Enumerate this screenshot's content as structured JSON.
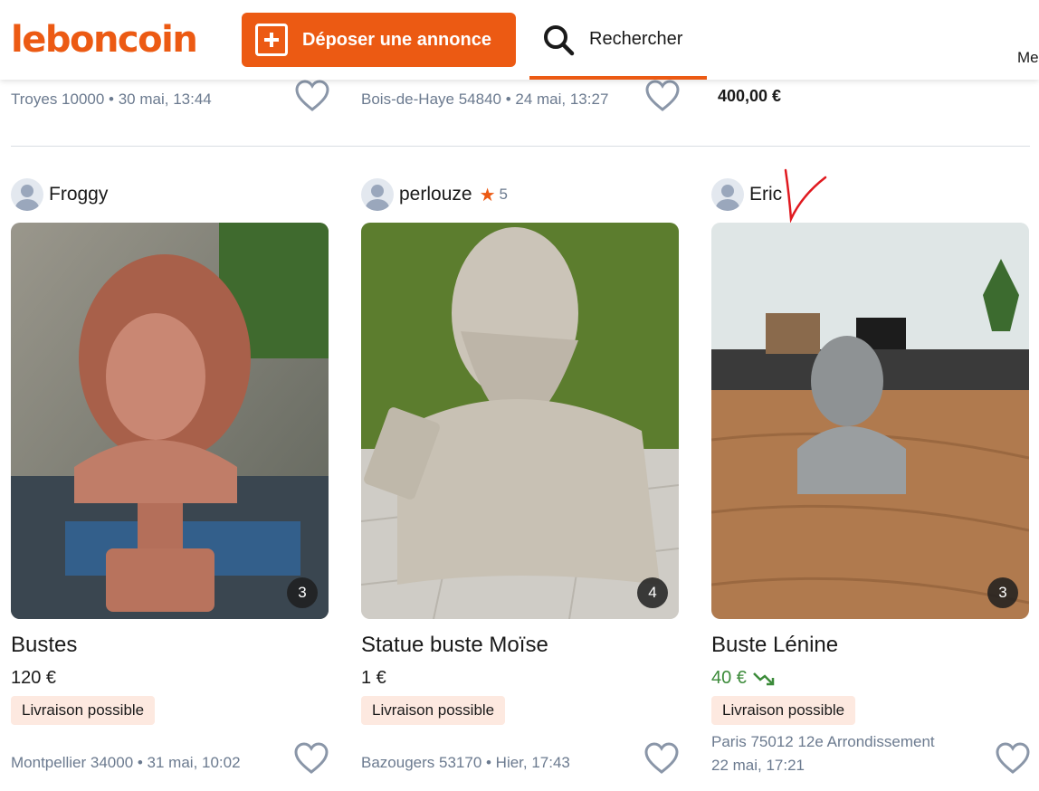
{
  "header": {
    "logo": "leboncoin",
    "post_button": "Déposer une annonce",
    "search_label": "Rechercher",
    "menu_partial": "Me"
  },
  "previous_row": [
    {
      "meta": "Troyes 10000 • 30 mai, 13:44"
    },
    {
      "meta": "Bois-de-Haye 54840 • 24 mai, 13:27"
    },
    {
      "price": "400,00 €"
    }
  ],
  "listings": [
    {
      "seller": "Froggy",
      "rating": "",
      "photo_count": "3",
      "title": "Bustes",
      "price": "120 €",
      "badge": "Livraison possible",
      "location": "Montpellier 34000 • 31 mai, 10:02"
    },
    {
      "seller": "perlouze",
      "rating": "5",
      "photo_count": "4",
      "title": "Statue buste Moïse",
      "price": "1 €",
      "badge": "Livraison possible",
      "location": "Bazougers 53170 • Hier, 17:43"
    },
    {
      "seller": "Eric",
      "rating": "",
      "photo_count": "3",
      "title": "Buste Lénine",
      "price": "40 €",
      "price_color": "#3c8b3a",
      "badge": "Livraison possible",
      "location_line1": "Paris 75012 12e Arrondissement",
      "location_line2": "22 mai, 17:21"
    }
  ],
  "colors": {
    "brand": "#ec5a13",
    "meta_text": "#6b7a8f",
    "badge_bg": "#fde9e0",
    "price_drop": "#3c8b3a"
  },
  "icons": [
    "plus-square-icon",
    "search-icon",
    "heart-icon",
    "star-icon",
    "trend-down-icon",
    "user-avatar-icon"
  ]
}
